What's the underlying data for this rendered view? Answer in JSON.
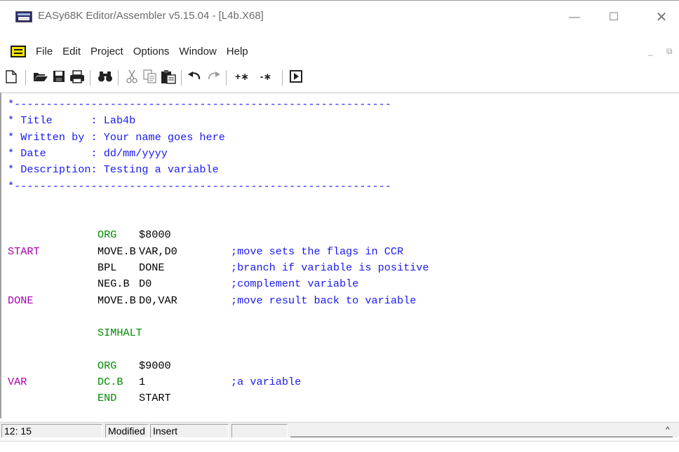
{
  "window": {
    "title": "EASy68K Editor/Assembler v5.15.04 - [L4b.X68]",
    "min_glyph": "—",
    "max_glyph": "☐",
    "close_glyph": "✕"
  },
  "menubar": {
    "items": [
      "File",
      "Edit",
      "Project",
      "Options",
      "Window",
      "Help"
    ],
    "mdi_controls": "_ ⧉ ✕"
  },
  "toolbar": {
    "buttons": [
      "new-file-icon",
      "open-folder-icon",
      "save-disk-icon",
      "print-icon",
      "find-binoculars-icon",
      "cut-scissors-icon",
      "copy-icon",
      "paste-clipboard-icon",
      "undo-icon",
      "redo-icon",
      "comment-add-icon",
      "comment-remove-icon",
      "assemble-run-icon"
    ],
    "comment_add": "+∗",
    "comment_remove": "-∗"
  },
  "editor": {
    "lines": [
      {
        "label": "",
        "text": "*-----------------------------------------------------------",
        "kind": "comment"
      },
      {
        "label": "",
        "text": "* Title      : Lab4b",
        "kind": "comment"
      },
      {
        "label": "",
        "text": "* Written by : Your name goes here",
        "kind": "comment"
      },
      {
        "label": "",
        "text": "* Date       : dd/mm/yyyy",
        "kind": "comment"
      },
      {
        "label": "",
        "text": "* Description: Testing a variable",
        "kind": "comment"
      },
      {
        "label": "",
        "text": "*-----------------------------------------------------------",
        "kind": "comment"
      },
      {
        "label": "",
        "text": "",
        "kind": "blank"
      },
      {
        "label": "",
        "text": "",
        "kind": "blank"
      },
      {
        "label": "",
        "op": "ORG",
        "operand": "$8000",
        "comment": "",
        "kind": "code-directive"
      },
      {
        "label": "START",
        "op": "MOVE.B",
        "operand": "VAR,D0",
        "comment": ";move sets the flags in CCR",
        "kind": "code"
      },
      {
        "label": "",
        "op": "BPL",
        "operand": "DONE",
        "comment": ";branch if variable is positive",
        "kind": "code"
      },
      {
        "label": "",
        "op": "NEG.B",
        "operand": "D0",
        "comment": ";complement variable",
        "kind": "code"
      },
      {
        "label": "DONE",
        "op": "MOVE.B",
        "operand": "D0,VAR",
        "comment": ";move result back to variable",
        "kind": "code"
      },
      {
        "label": "",
        "text": "",
        "kind": "blank"
      },
      {
        "label": "",
        "op": "SIMHALT",
        "operand": "",
        "comment": "",
        "kind": "code-directive"
      },
      {
        "label": "",
        "text": "",
        "kind": "blank"
      },
      {
        "label": "",
        "op": "ORG",
        "operand": "$9000",
        "comment": "",
        "kind": "code-directive"
      },
      {
        "label": "VAR",
        "op": "DC.B",
        "operand": "1",
        "comment": ";a variable",
        "kind": "code-directive"
      },
      {
        "label": "",
        "op": "END",
        "operand": "START",
        "comment": "",
        "kind": "code-directive"
      }
    ],
    "colors": {
      "comment": "#1a1aee",
      "label": "#a800a8",
      "directive": "#008a00",
      "text": "#000000"
    }
  },
  "statusbar": {
    "position": "12: 15",
    "modified": "Modified",
    "mode": "Insert",
    "caret": "^"
  }
}
